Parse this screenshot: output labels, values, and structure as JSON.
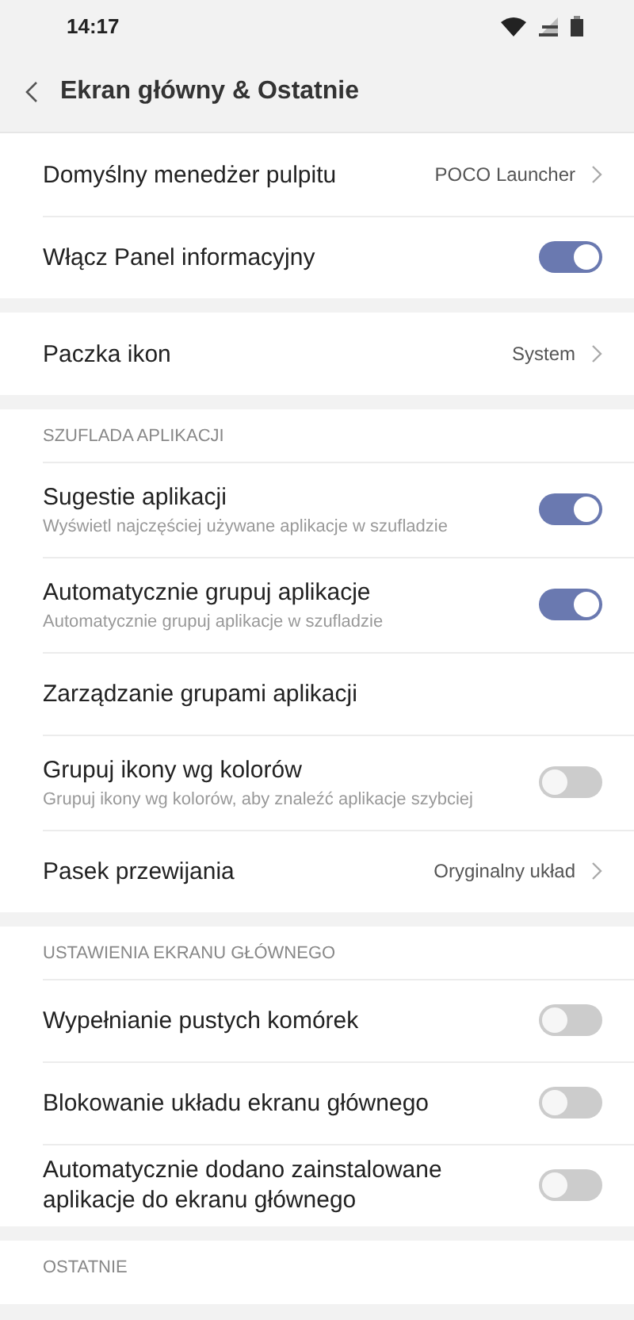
{
  "status_bar": {
    "time": "14:17"
  },
  "header": {
    "title": "Ekran główny & Ostatnie"
  },
  "sections": [
    {
      "rows": [
        {
          "kind": "link",
          "label": "Domyślny menedżer pulpitu",
          "value": "POCO Launcher"
        },
        {
          "kind": "toggle",
          "label": "Włącz Panel informacyjny",
          "on": true
        }
      ]
    },
    {
      "rows": [
        {
          "kind": "link",
          "label": "Paczka ikon",
          "value": "System"
        }
      ]
    },
    {
      "title": "SZUFLADA APLIKACJI",
      "rows": [
        {
          "kind": "toggle",
          "label": "Sugestie aplikacji",
          "description": "Wyświetl najczęściej używane aplikacje w szufladzie",
          "on": true
        },
        {
          "kind": "toggle",
          "label": "Automatycznie grupuj aplikacje",
          "description": "Automatycznie grupuj aplikacje w szufladzie",
          "on": true
        },
        {
          "kind": "plain",
          "label": "Zarządzanie grupami aplikacji"
        },
        {
          "kind": "toggle",
          "label": "Grupuj ikony wg kolorów",
          "description": "Grupuj ikony wg kolorów, aby znaleźć aplikacje szybciej",
          "on": false
        },
        {
          "kind": "link",
          "label": "Pasek przewijania",
          "value": "Oryginalny układ"
        }
      ]
    },
    {
      "title": "USTAWIENIA EKRANU GŁÓWNEGO",
      "rows": [
        {
          "kind": "toggle",
          "label": "Wypełnianie pustych komórek",
          "on": false
        },
        {
          "kind": "toggle",
          "label": "Blokowanie układu ekranu głównego",
          "on": false
        },
        {
          "kind": "toggle",
          "label": "Automatycznie dodano zainstalowane aplikacje do ekranu głównego",
          "on": false
        }
      ]
    },
    {
      "title": "OSTATNIE"
    }
  ]
}
